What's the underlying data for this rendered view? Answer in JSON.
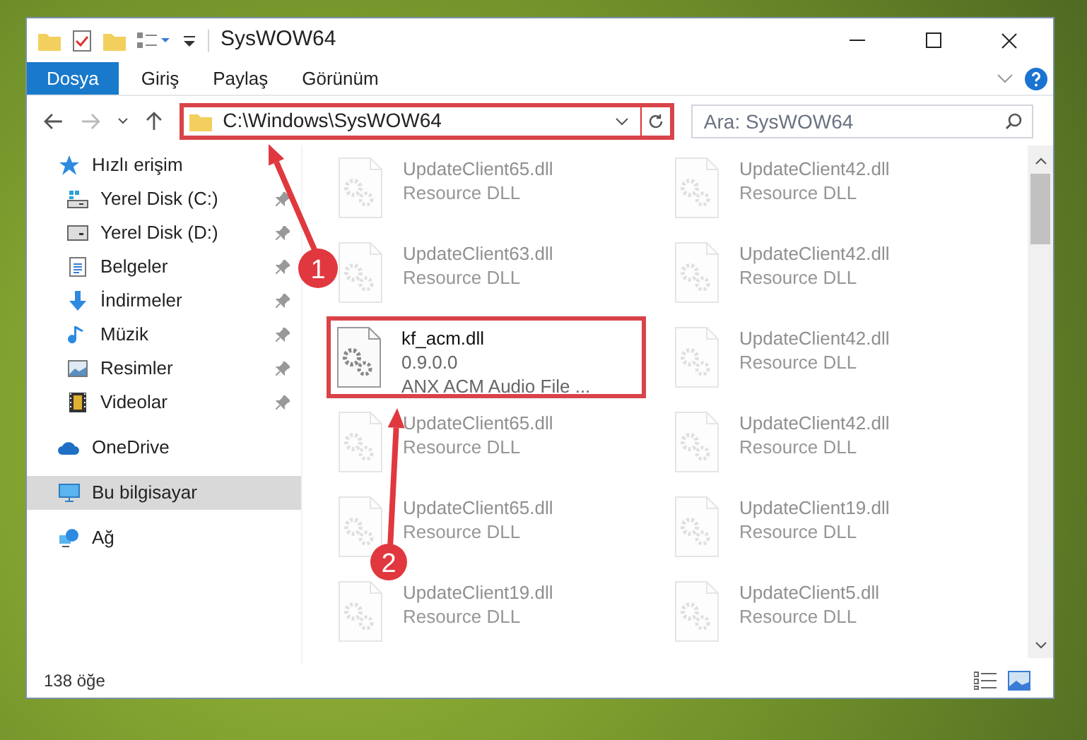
{
  "window": {
    "title": "SysWOW64"
  },
  "ribbon_tabs": [
    {
      "label": "Dosya",
      "selected": true
    },
    {
      "label": "Giriş",
      "selected": false
    },
    {
      "label": "Paylaş",
      "selected": false
    },
    {
      "label": "Görünüm",
      "selected": false
    }
  ],
  "address": {
    "path": "C:\\Windows\\SysWOW64",
    "highlighted": true
  },
  "search": {
    "placeholder": "Ara: SysWOW64"
  },
  "sidebar": {
    "items": [
      {
        "label": "Hızlı erişim",
        "kind": "star",
        "selected": false,
        "children": [
          {
            "label": "Yerel Disk (C:)",
            "kind": "drive-system",
            "pinned": true
          },
          {
            "label": "Yerel Disk (D:)",
            "kind": "drive",
            "pinned": true
          },
          {
            "label": "Belgeler",
            "kind": "document",
            "pinned": true
          },
          {
            "label": "İndirmeler",
            "kind": "download",
            "pinned": true
          },
          {
            "label": "Müzik",
            "kind": "music",
            "pinned": true
          },
          {
            "label": "Resimler",
            "kind": "picture",
            "pinned": true
          },
          {
            "label": "Videolar",
            "kind": "video",
            "pinned": true
          }
        ]
      },
      {
        "label": "OneDrive",
        "kind": "cloud",
        "selected": false
      },
      {
        "label": "Bu bilgisayar",
        "kind": "computer",
        "selected": true
      },
      {
        "label": "Ağ",
        "kind": "network",
        "selected": false
      }
    ]
  },
  "files": [
    {
      "name": "UpdateClient65.dll",
      "lines": [
        "Resource DLL"
      ],
      "faded": true,
      "highlighted": false
    },
    {
      "name": "UpdateClient42.dll",
      "lines": [
        "Resource DLL"
      ],
      "faded": true,
      "highlighted": false
    },
    {
      "name": "UpdateClient63.dll",
      "lines": [
        "Resource DLL"
      ],
      "faded": true,
      "highlighted": false
    },
    {
      "name": "UpdateClient42.dll",
      "lines": [
        "Resource DLL"
      ],
      "faded": true,
      "highlighted": false
    },
    {
      "name": "kf_acm.dll",
      "lines": [
        "0.9.0.0",
        "ANX ACM Audio File ..."
      ],
      "faded": false,
      "highlighted": true
    },
    {
      "name": "UpdateClient42.dll",
      "lines": [
        "Resource DLL"
      ],
      "faded": true,
      "highlighted": false
    },
    {
      "name": "UpdateClient65.dll",
      "lines": [
        "Resource DLL"
      ],
      "faded": true,
      "highlighted": false
    },
    {
      "name": "UpdateClient42.dll",
      "lines": [
        "Resource DLL"
      ],
      "faded": true,
      "highlighted": false
    },
    {
      "name": "UpdateClient65.dll",
      "lines": [
        "Resource DLL"
      ],
      "faded": true,
      "highlighted": false
    },
    {
      "name": "UpdateClient19.dll",
      "lines": [
        "Resource DLL"
      ],
      "faded": true,
      "highlighted": false
    },
    {
      "name": "UpdateClient19.dll",
      "lines": [
        "Resource DLL"
      ],
      "faded": true,
      "highlighted": false
    },
    {
      "name": "UpdateClient5.dll",
      "lines": [
        "Resource DLL"
      ],
      "faded": true,
      "highlighted": false
    }
  ],
  "status_bar": {
    "item_count": "138 öğe"
  },
  "annotations": [
    {
      "label": "1"
    },
    {
      "label": "2"
    }
  ]
}
